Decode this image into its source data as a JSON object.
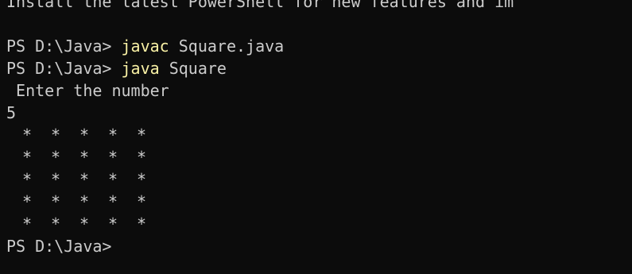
{
  "terminal": {
    "banner": "Install the latest PowerShell for new features and im",
    "prompt": "PS D:\\Java>",
    "commands": [
      {
        "cmd": "javac",
        "args": " Square.java"
      },
      {
        "cmd": "java",
        "args": " Square"
      }
    ],
    "output": {
      "enter_prompt": " Enter the number",
      "input_value": "5",
      "star_char": "*",
      "star_rows": 5,
      "star_cols": 5
    },
    "final_prompt": "PS D:\\Java>"
  },
  "colors": {
    "background": "#0c0c0c",
    "text": "#cccccc",
    "command": "#f9f1a5"
  }
}
